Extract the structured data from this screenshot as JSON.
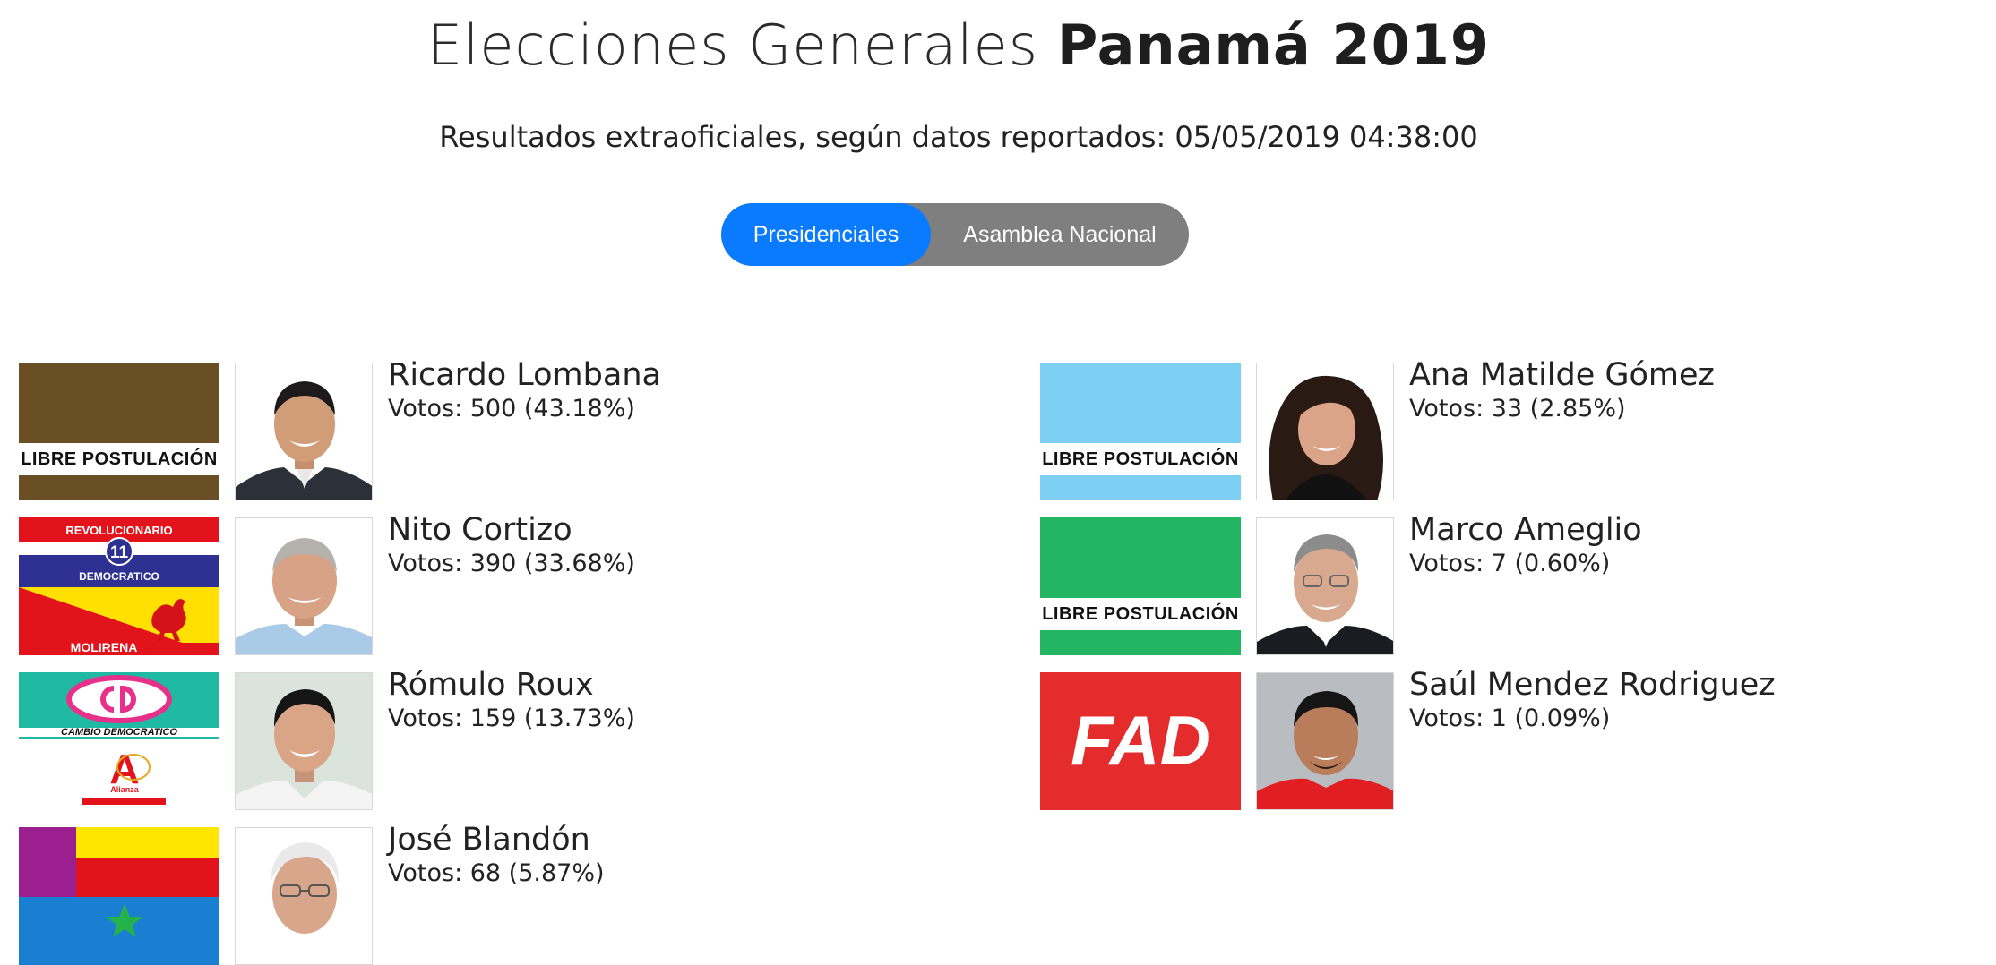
{
  "header": {
    "title_light": "Elecciones Generales",
    "title_bold": "Panamá 2019",
    "subtitle": "Resultados extraoficiales, según datos reportados: 05/05/2019 04:38:00"
  },
  "tabs": {
    "presidenciales": "Presidenciales",
    "asamblea": "Asamblea Nacional",
    "active": "Presidenciales"
  },
  "candidates": [
    {
      "name": "Ricardo Lombana",
      "votes": "Votos: 500 (43.18%)",
      "party_label": "LIBRE POSTULACIÓN",
      "party_color": "#6b4f24"
    },
    {
      "name": "Nito Cortizo",
      "votes": "Votos: 390 (33.68%)",
      "party_top": "REVOLUCIONARIO",
      "party_number": "11",
      "party_mid": "DEMOCRATICO",
      "party_bottom": "MOLIRENA"
    },
    {
      "name": "Rómulo Roux",
      "votes": "Votos: 159 (13.73%)",
      "party_caption": "CAMBIO DEMOCRATICO",
      "party_alianza": "Alianza"
    },
    {
      "name": "José Blandón",
      "votes": "Votos: 68 (5.87%)"
    },
    {
      "name": "Ana Matilde Gómez",
      "votes": "Votos: 33 (2.85%)",
      "party_label": "LIBRE POSTULACIÓN",
      "party_color": "#7dcff4"
    },
    {
      "name": "Marco Ameglio",
      "votes": "Votos: 7 (0.60%)",
      "party_label": "LIBRE POSTULACIÓN",
      "party_color": "#24b563"
    },
    {
      "name": "Saúl Mendez Rodriguez",
      "votes": "Votos: 1 (0.09%)",
      "party_label": "FAD",
      "party_color": "#e52c2c"
    }
  ]
}
